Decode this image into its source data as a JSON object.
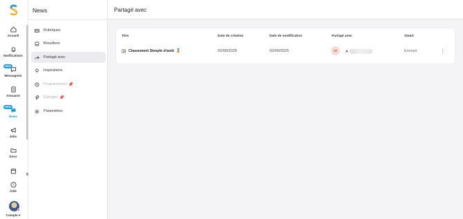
{
  "rail": {
    "items": [
      {
        "label": "Accueil",
        "icon": "home-icon"
      },
      {
        "label": "Notifications",
        "icon": "bell-icon"
      },
      {
        "label": "Messagerie",
        "icon": "chat-icon",
        "badge": "NEW"
      },
      {
        "label": "Annuaire",
        "icon": "directory-icon"
      },
      {
        "label": "News",
        "icon": "news-icon",
        "badge": "NEW",
        "active": true
      },
      {
        "label": "Jobs",
        "icon": "megaphone-icon"
      },
      {
        "label": "Docs",
        "icon": "folder-icon"
      },
      {
        "label": "",
        "icon": "calendar-icon"
      },
      {
        "label": "Aide",
        "icon": "help-icon"
      },
      {
        "label": "Compte",
        "icon": "avatar"
      }
    ]
  },
  "subnav": {
    "title": "News",
    "items": [
      {
        "label": "Rubriques",
        "icon": "inbox-icon"
      },
      {
        "label": "Brouillons",
        "icon": "draft-icon"
      },
      {
        "label": "Partagé avec",
        "icon": "share-icon",
        "active": true
      },
      {
        "label": "Inspirations",
        "icon": "lightbulb-icon"
      },
      {
        "label": "Programmées",
        "icon": "clock-icon",
        "disabled": true,
        "pin": true
      },
      {
        "label": "Épinglés",
        "icon": "paperclip-icon",
        "disabled": true,
        "pin": true
      },
      {
        "label": "Paramètres",
        "icon": "gear-icon"
      }
    ]
  },
  "page": {
    "title": "Partagé avec"
  },
  "table": {
    "headers": [
      "Titre",
      "Date de création",
      "Date de modification",
      "Partagé avec",
      "Statut"
    ],
    "rows": [
      {
        "title": "Classement Steeple d'août",
        "created": "02/09/2025",
        "modified": "02/09/2025",
        "shared_initials": "AT",
        "shared_name": "A",
        "status": "Envoyé",
        "menu": "⋮"
      }
    ]
  },
  "colors": {
    "accent": "#1d9bd7",
    "active_bg": "#ececf0",
    "pin": "#e0463c"
  }
}
